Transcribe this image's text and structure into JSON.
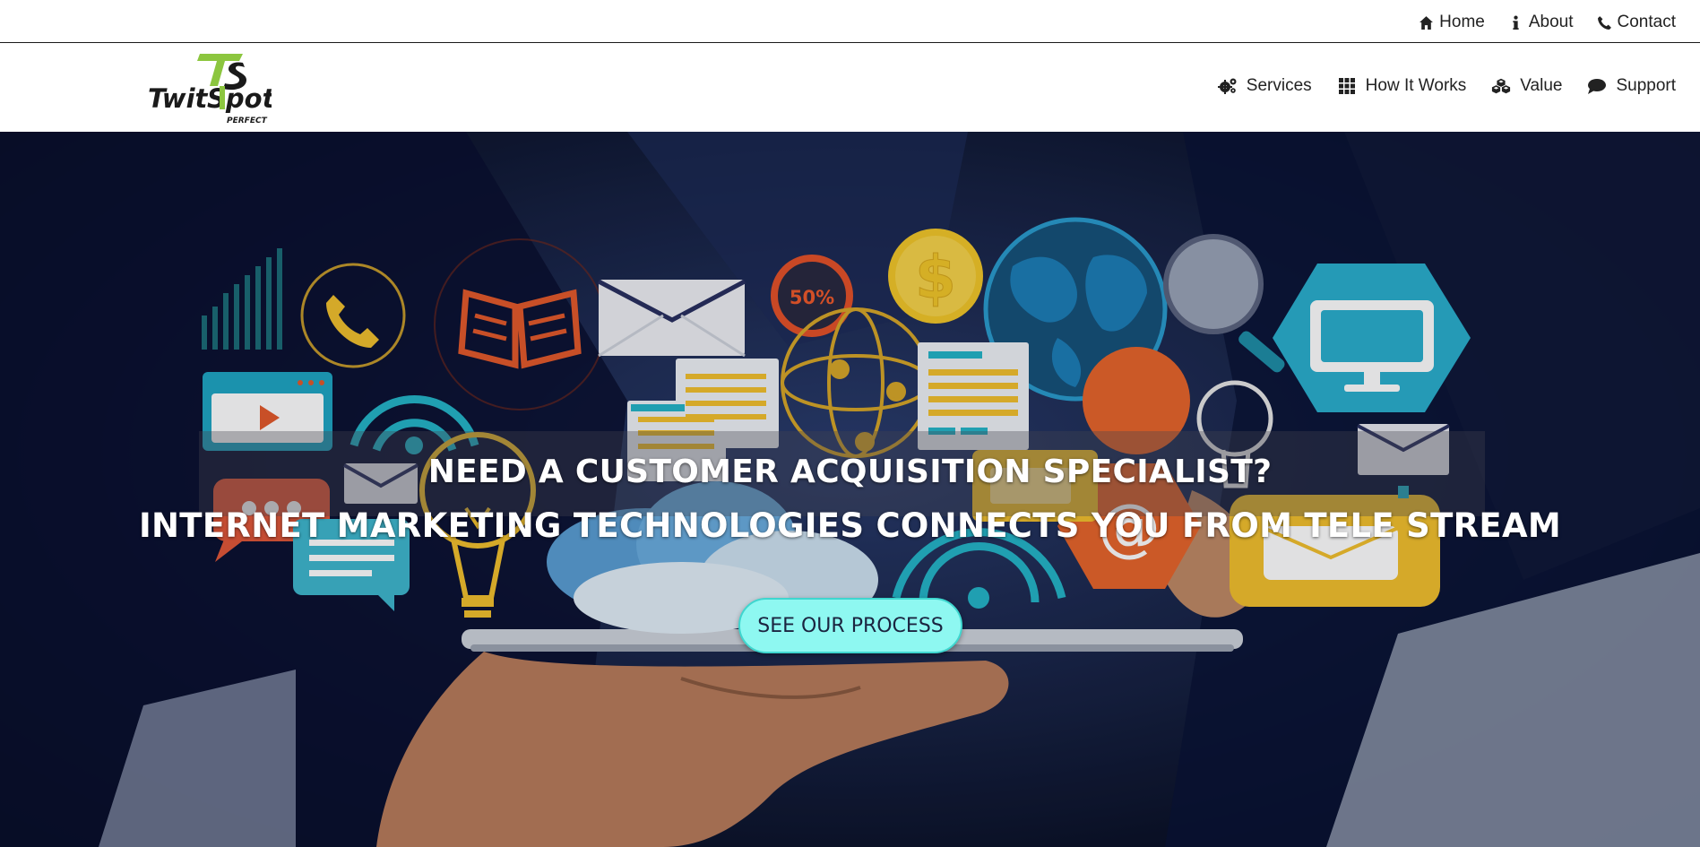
{
  "top_nav": {
    "items": [
      {
        "label": "Home",
        "icon": "home-icon"
      },
      {
        "label": "About",
        "icon": "info-icon"
      },
      {
        "label": "Contact",
        "icon": "phone-icon"
      }
    ]
  },
  "brand": {
    "logo_line1": "Twit Spot",
    "logo_line2": "PERFECT",
    "logo_mark": "TS",
    "accent": "#8cc63f"
  },
  "main_nav": {
    "items": [
      {
        "label": "Services",
        "icon": "gears-icon"
      },
      {
        "label": "How It Works",
        "icon": "grid-icon"
      },
      {
        "label": "Value",
        "icon": "cubes-icon"
      },
      {
        "label": "Support",
        "icon": "chat-bubble-icon"
      }
    ]
  },
  "hero": {
    "heading_line1": "NEED A CUSTOMER ACQUISITION SPECIALIST?",
    "heading_line2": "INTERNET MARKETING TECHNOLOGIES CONNECTS YOU FROM TELE STREAM",
    "cta_label": "SEE OUR PROCESS",
    "cta_color": "#8ef8f1",
    "illustration_badge": "50%",
    "illustration_currency": "$"
  }
}
